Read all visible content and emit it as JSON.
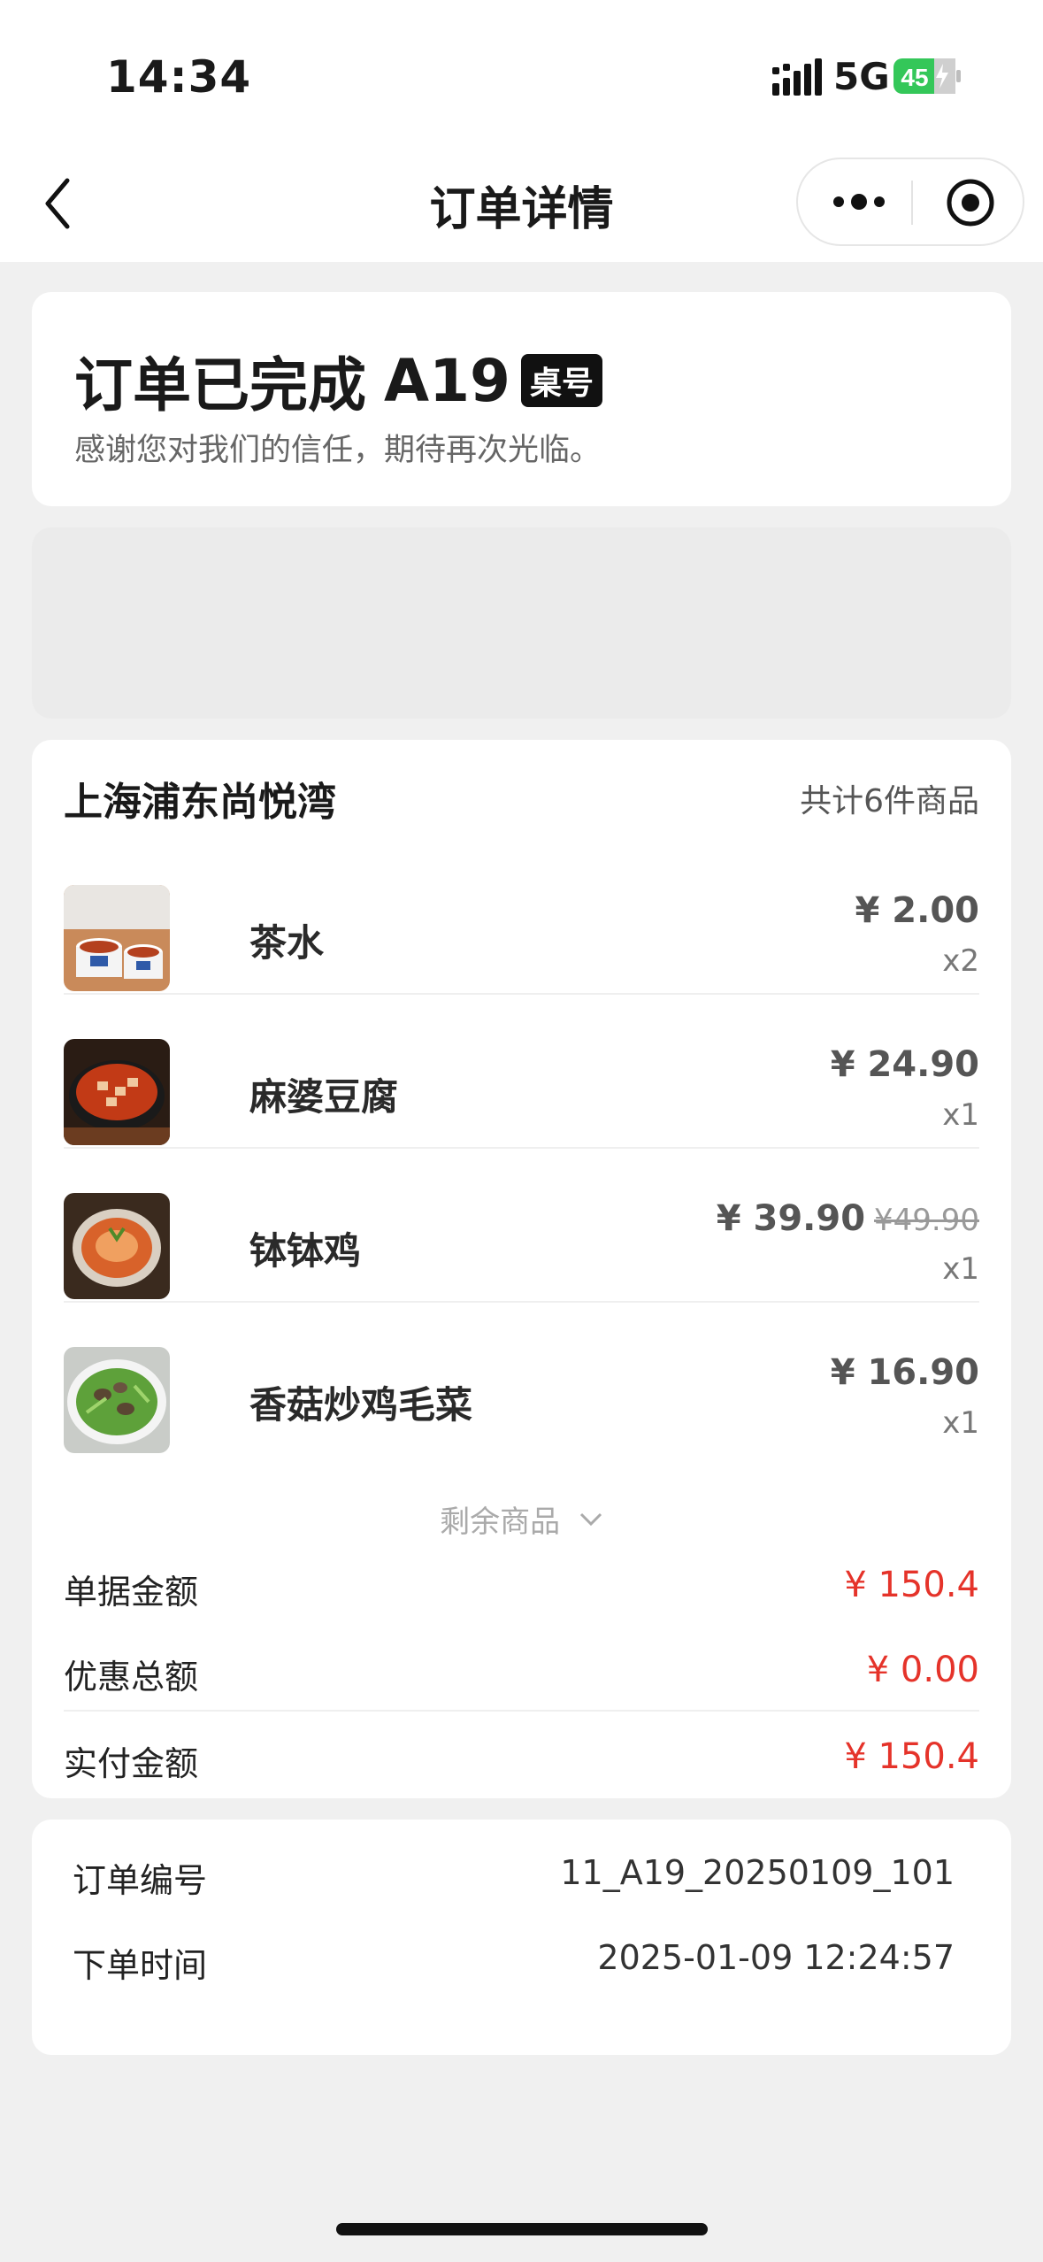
{
  "status_bar": {
    "time": "14:34",
    "network": "5G",
    "battery": "45"
  },
  "nav": {
    "title": "订单详情"
  },
  "order_status": {
    "title": "订单已完成",
    "table_code": "A19",
    "table_tag": "桌号",
    "subtitle": "感谢您对我们的信任，期待再次光临。"
  },
  "order": {
    "store_name": "上海浦东尚悦湾",
    "item_count_label": "共计6件商品",
    "items": [
      {
        "name": "茶水",
        "price": "¥ 2.00",
        "original_price": "",
        "qty": "x2",
        "image": "tea-image"
      },
      {
        "name": "麻婆豆腐",
        "price": "¥ 24.90",
        "original_price": "",
        "qty": "x1",
        "image": "mapo-tofu-image"
      },
      {
        "name": "钵钵鸡",
        "price": "¥ 39.90",
        "original_price": "¥49.90",
        "qty": "x1",
        "image": "bobo-chicken-image"
      },
      {
        "name": "香菇炒鸡毛菜",
        "price": "¥ 16.90",
        "original_price": "",
        "qty": "x1",
        "image": "mushroom-greens-image"
      }
    ],
    "more_label": "剩余商品",
    "summary": {
      "bill_label": "单据金额",
      "bill_value": "¥ 150.4",
      "discount_label": "优惠总额",
      "discount_value": "¥ 0.00",
      "paid_label": "实付金额",
      "paid_value": "¥ 150.4"
    }
  },
  "info": {
    "order_no_label": "订单编号",
    "order_no": "11_A19_20250109_101",
    "order_time_label": "下单时间",
    "order_time": "2025-01-09 12:24:57"
  },
  "colors": {
    "accent_price": "#e5332a",
    "tag_bg": "#111111"
  }
}
